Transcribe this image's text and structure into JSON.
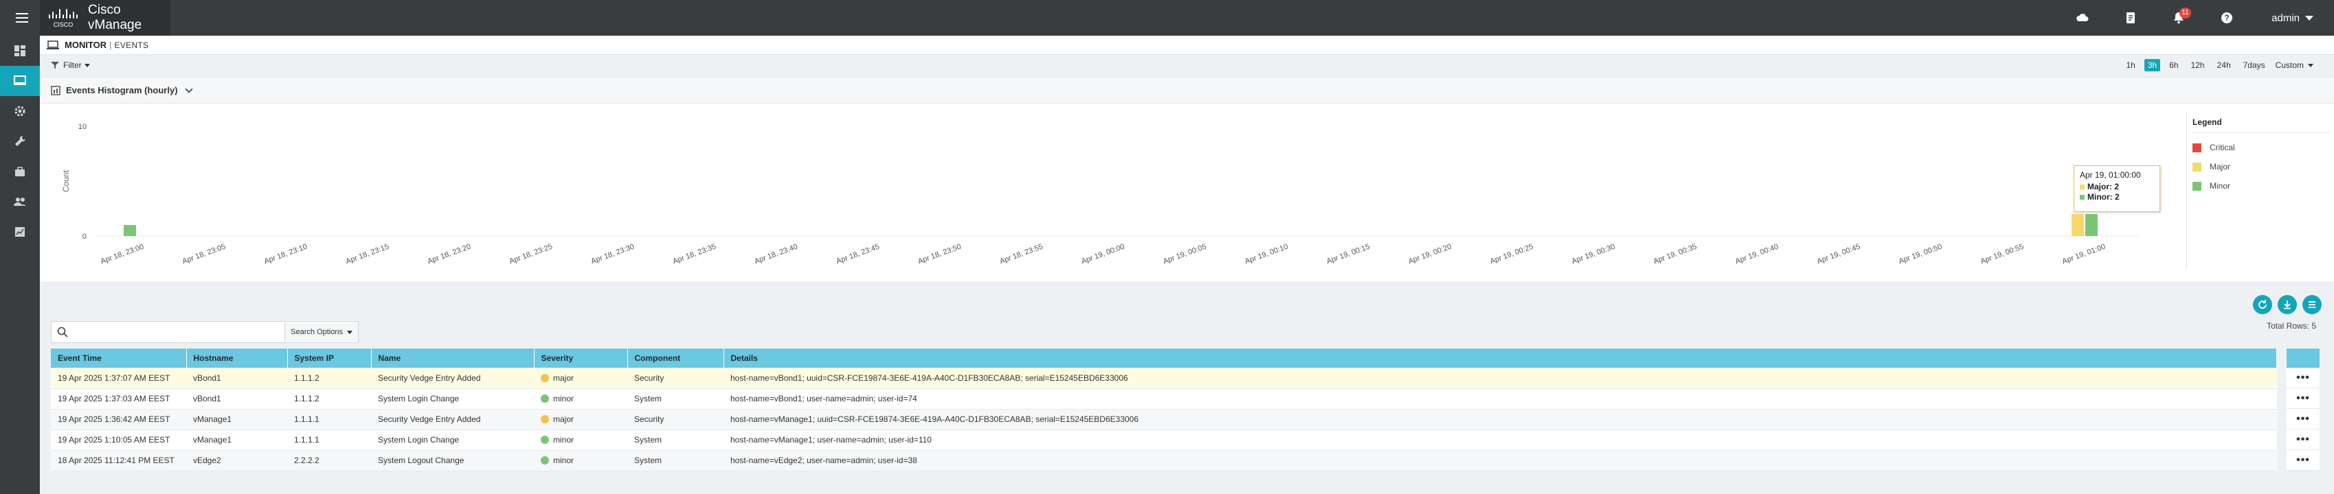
{
  "app": {
    "title": "Cisco vManage",
    "user": "admin",
    "notification_count": "11"
  },
  "breadcrumb": {
    "section": "MONITOR",
    "separator": "|",
    "page": "EVENTS"
  },
  "filter": {
    "label": "Filter"
  },
  "time_range": {
    "options": [
      "1h",
      "3h",
      "6h",
      "12h",
      "24h",
      "7days"
    ],
    "selected": "3h",
    "custom_label": "Custom"
  },
  "histogram": {
    "title": "Events Histogram (hourly)"
  },
  "chart_data": {
    "type": "bar",
    "ylabel": "Count",
    "yticks": [
      "10",
      "0"
    ],
    "ylim": [
      0,
      10
    ],
    "x_tick_labels": [
      "Apr 18, 23:00",
      "Apr 18, 23:05",
      "Apr 18, 23:10",
      "Apr 18, 23:15",
      "Apr 18, 23:20",
      "Apr 18, 23:25",
      "Apr 18, 23:30",
      "Apr 18, 23:35",
      "Apr 18, 23:40",
      "Apr 18, 23:45",
      "Apr 18, 23:50",
      "Apr 18, 23:55",
      "Apr 19, 00:00",
      "Apr 19, 00:05",
      "Apr 19, 00:10",
      "Apr 19, 00:15",
      "Apr 19, 00:20",
      "Apr 19, 00:25",
      "Apr 19, 00:30",
      "Apr 19, 00:35",
      "Apr 19, 00:40",
      "Apr 19, 00:45",
      "Apr 19, 00:50",
      "Apr 19, 00:55",
      "Apr 19, 01:00"
    ],
    "categories": [
      "Apr 18, 23:00",
      "Apr 19, 01:00"
    ],
    "series": [
      {
        "name": "Critical",
        "color": "#e3483c",
        "values": [
          0,
          0
        ]
      },
      {
        "name": "Major",
        "color": "#f6d76b",
        "values": [
          0,
          2
        ]
      },
      {
        "name": "Minor",
        "color": "#7cc576",
        "values": [
          1,
          2
        ]
      }
    ],
    "legend": {
      "title": "Legend",
      "position": "right"
    },
    "tooltip": {
      "time": "Apr 19, 01:00:00",
      "major": "Major: 2",
      "minor": "Minor: 2"
    }
  },
  "table": {
    "search_placeholder": "",
    "search_options_label": "Search Options",
    "total_rows_label": "Total Rows: 5",
    "columns": [
      "Event Time",
      "Hostname",
      "System IP",
      "Name",
      "Severity",
      "Component",
      "Details"
    ],
    "rows": [
      {
        "time": "19 Apr 2025 1:37:07 AM EEST",
        "hostname": "vBond1",
        "system_ip": "1.1.1.2",
        "name": "Security Vedge Entry Added",
        "severity": "major",
        "component": "Security",
        "details": "host-name=vBond1; uuid=CSR-FCE19874-3E6E-419A-A40C-D1FB30ECA8AB; serial=E15245EBD6E33006"
      },
      {
        "time": "19 Apr 2025 1:37:03 AM EEST",
        "hostname": "vBond1",
        "system_ip": "1.1.1.2",
        "name": "System Login Change",
        "severity": "minor",
        "component": "System",
        "details": "host-name=vBond1; user-name=admin; user-id=74"
      },
      {
        "time": "19 Apr 2025 1:36:42 AM EEST",
        "hostname": "vManage1",
        "system_ip": "1.1.1.1",
        "name": "Security Vedge Entry Added",
        "severity": "major",
        "component": "Security",
        "details": "host-name=vManage1; uuid=CSR-FCE19874-3E6E-419A-A40C-D1FB30ECA8AB; serial=E15245EBD6E33006"
      },
      {
        "time": "19 Apr 2025 1:10:05 AM EEST",
        "hostname": "vManage1",
        "system_ip": "1.1.1.1",
        "name": "System Login Change",
        "severity": "minor",
        "component": "System",
        "details": "host-name=vManage1; user-name=admin; user-id=110"
      },
      {
        "time": "18 Apr 2025 11:12:41 PM EEST",
        "hostname": "vEdge2",
        "system_ip": "2.2.2.2",
        "name": "System Logout Change",
        "severity": "minor",
        "component": "System",
        "details": "host-name=vEdge2; user-name=admin; user-id=38"
      }
    ],
    "row_menu_label": "•••"
  },
  "icons": {
    "topbar": [
      "menu-icon",
      "cloud-icon",
      "tasks-icon",
      "bell-icon",
      "help-icon"
    ],
    "sidebar": [
      "dashboard-icon",
      "monitor-icon",
      "configuration-icon",
      "tools-icon",
      "maintenance-icon",
      "administration-icon",
      "analytics-icon"
    ],
    "actions": [
      "refresh-icon",
      "download-icon",
      "columns-icon"
    ]
  }
}
